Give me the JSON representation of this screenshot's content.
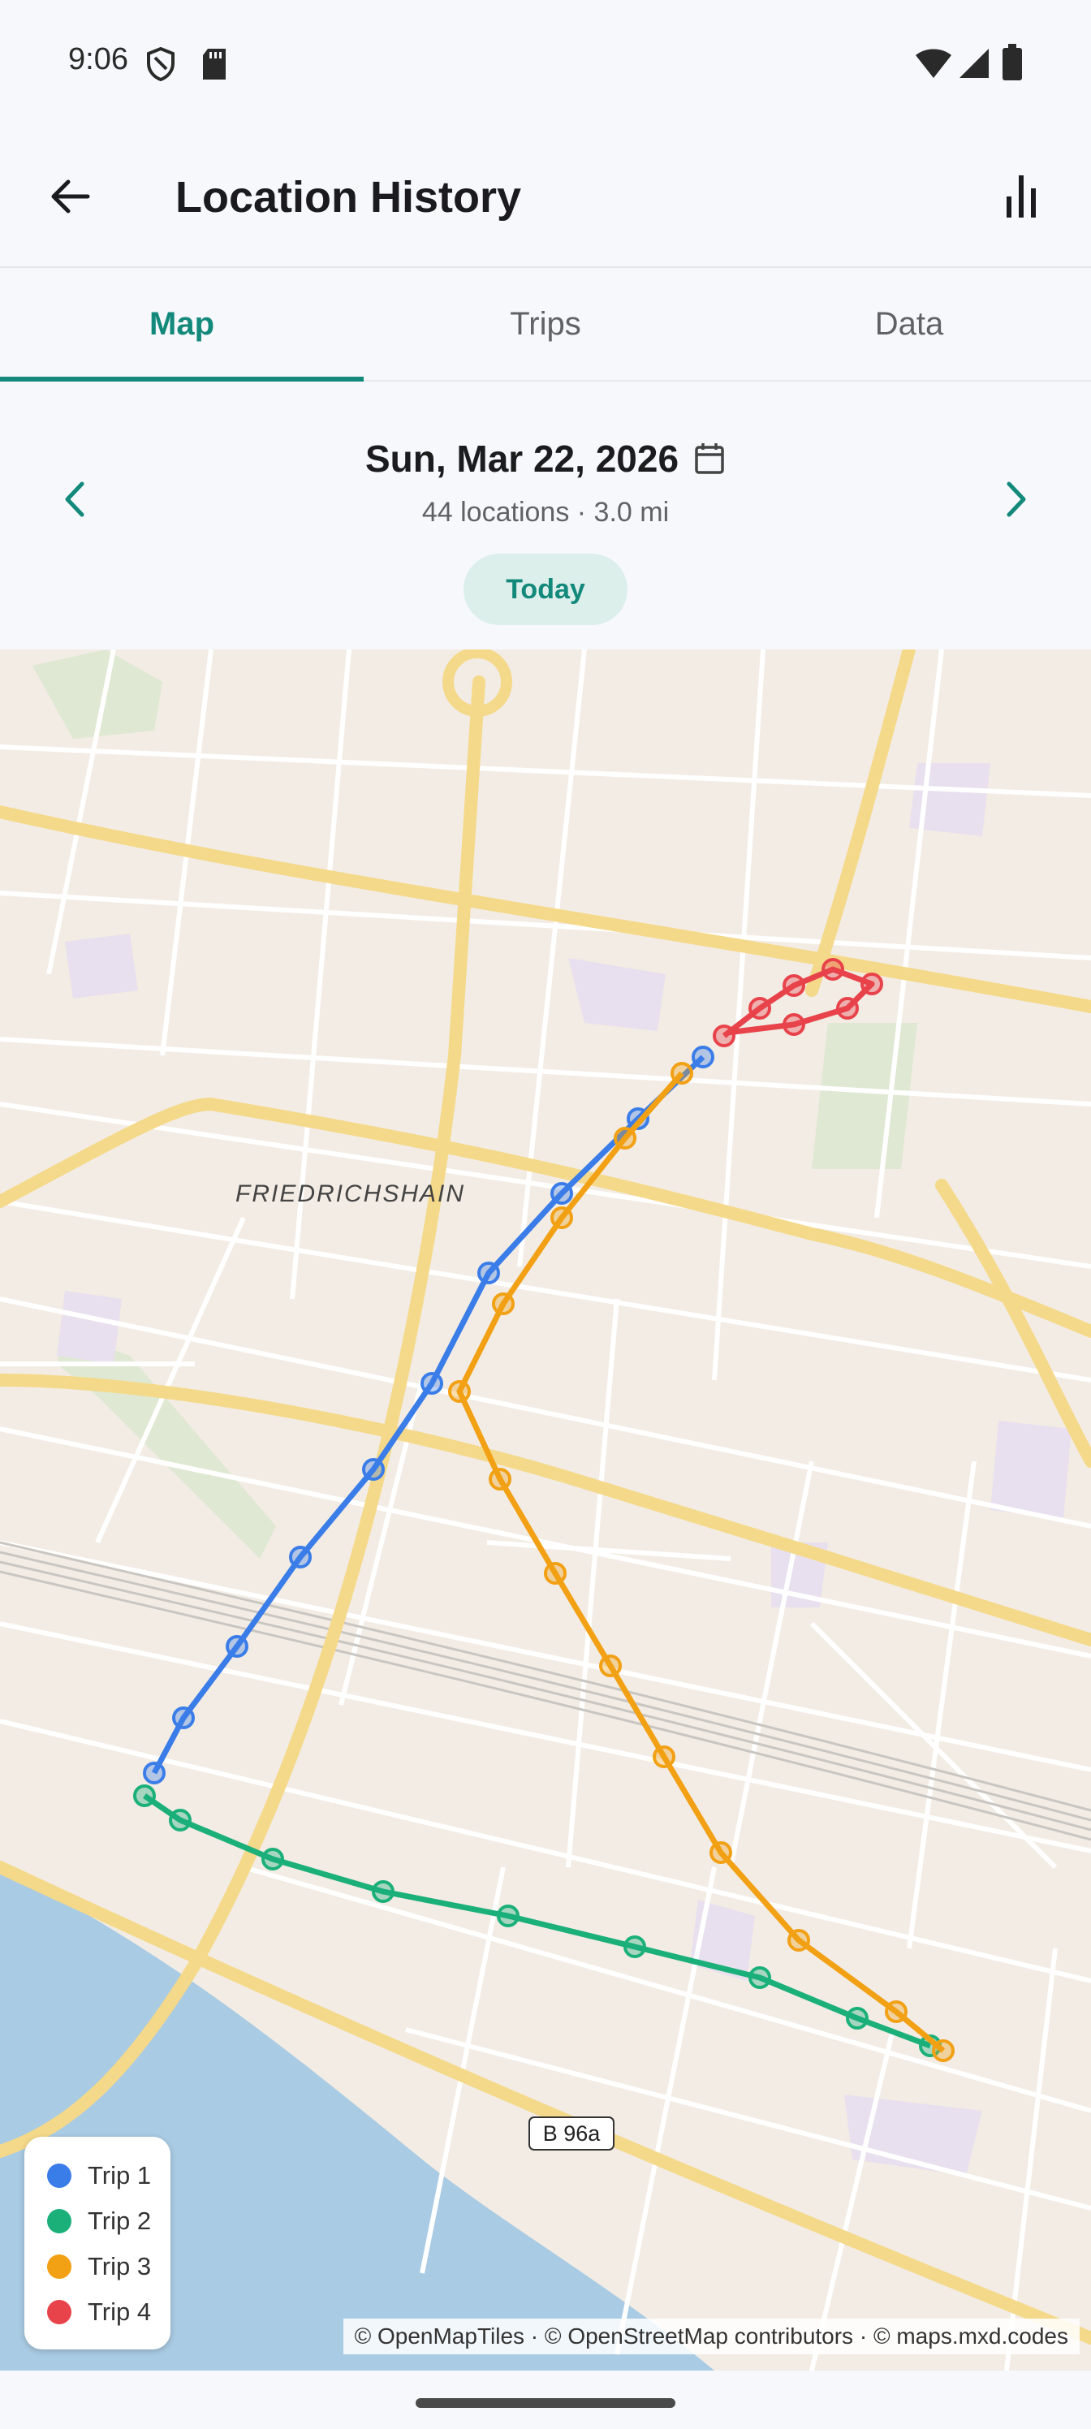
{
  "status": {
    "time": "9:06",
    "icons": [
      "shield-icon",
      "sd-card-icon",
      "wifi-icon",
      "signal-icon",
      "battery-icon"
    ]
  },
  "header": {
    "title": "Location History",
    "back_icon": "arrow-back-icon",
    "action_icon": "bar-chart-icon"
  },
  "tabs": [
    {
      "label": "Map",
      "active": true
    },
    {
      "label": "Trips",
      "active": false
    },
    {
      "label": "Data",
      "active": false
    }
  ],
  "date_nav": {
    "date": "Sun, Mar 22, 2026",
    "summary": "44 locations · 3.0 mi",
    "today_label": "Today",
    "prev_icon": "chevron-left-icon",
    "next_icon": "chevron-right-icon",
    "calendar_icon": "calendar-icon"
  },
  "map": {
    "district_label": "FRIEDRICHSHAIN",
    "road_shield": "B 96a",
    "legend": [
      {
        "label": "Trip 1",
        "color": "#3b7de8"
      },
      {
        "label": "Trip 2",
        "color": "#1bb07a"
      },
      {
        "label": "Trip 3",
        "color": "#f2a014"
      },
      {
        "label": "Trip 4",
        "color": "#e8434a"
      }
    ],
    "attribution": "© OpenMapTiles · © OpenStreetMap contributors · © maps.mxd.codes"
  },
  "colors": {
    "accent": "#13897b",
    "trip1": "#3b7de8",
    "trip2": "#1bb07a",
    "trip3": "#f2a014",
    "trip4": "#e8434a"
  }
}
